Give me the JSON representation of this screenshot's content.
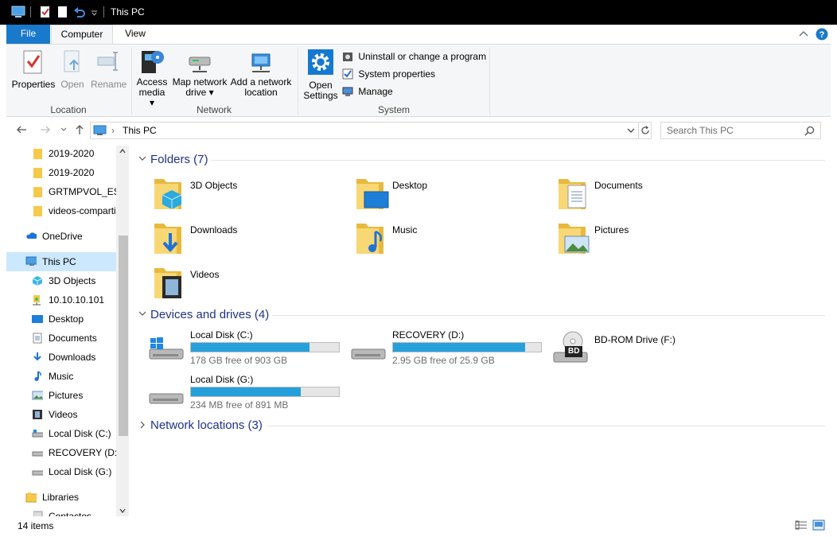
{
  "window": {
    "title": "This PC"
  },
  "tabs": {
    "file": "File",
    "computer": "Computer",
    "view": "View"
  },
  "ribbon": {
    "properties": "Properties",
    "open": "Open",
    "rename": "Rename",
    "access_media_l1": "Access",
    "access_media_l2": "media",
    "map_drive_l1": "Map network",
    "map_drive_l2": "drive",
    "add_location_l1": "Add a network",
    "add_location_l2": "location",
    "open_settings_l1": "Open",
    "open_settings_l2": "Settings",
    "uninstall": "Uninstall or change a program",
    "system_properties": "System properties",
    "manage": "Manage",
    "group_location": "Location",
    "group_network": "Network",
    "group_system": "System"
  },
  "address": {
    "path": "This PC",
    "separator": "›"
  },
  "search": {
    "placeholder": "Search This PC"
  },
  "nav": {
    "items": [
      {
        "label": "2019-2020",
        "icon": "folder-icon"
      },
      {
        "label": "2019-2020",
        "icon": "folder-icon"
      },
      {
        "label": "GRTMPVOL_ES_I",
        "icon": "folder-icon"
      },
      {
        "label": "videos-comparti",
        "icon": "folder-icon"
      },
      {
        "label": "OneDrive",
        "icon": "cloud-icon"
      },
      {
        "label": "This PC",
        "icon": "computer-icon"
      },
      {
        "label": "3D Objects",
        "icon": "cube-icon"
      },
      {
        "label": "10.10.10.101",
        "icon": "network-drive-icon"
      },
      {
        "label": "Desktop",
        "icon": "desktop-icon"
      },
      {
        "label": "Documents",
        "icon": "documents-icon"
      },
      {
        "label": "Downloads",
        "icon": "download-icon"
      },
      {
        "label": "Music",
        "icon": "music-icon"
      },
      {
        "label": "Pictures",
        "icon": "pictures-icon"
      },
      {
        "label": "Videos",
        "icon": "videos-icon"
      },
      {
        "label": "Local Disk (C:)",
        "icon": "drive-icon"
      },
      {
        "label": "RECOVERY (D:)",
        "icon": "drive-icon"
      },
      {
        "label": "Local Disk (G:)",
        "icon": "drive-icon"
      },
      {
        "label": "Libraries",
        "icon": "libraries-icon"
      },
      {
        "label": "Contactos",
        "icon": "folder-icon"
      }
    ]
  },
  "content": {
    "folders_header": "Folders (7)",
    "folders": [
      "3D Objects",
      "Desktop",
      "Documents",
      "Downloads",
      "Music",
      "Pictures",
      "Videos"
    ],
    "drives_header": "Devices and drives (4)",
    "drives": [
      {
        "name": "Local Disk (C:)",
        "free": "178 GB free of 903 GB",
        "used_fraction": 0.8
      },
      {
        "name": "RECOVERY (D:)",
        "free": "2.95 GB free of 25.9 GB",
        "used_fraction": 0.89
      },
      {
        "name": "BD-ROM Drive (F:)"
      },
      {
        "name": "Local Disk (G:)",
        "free": "234 MB free of 891 MB",
        "used_fraction": 0.74
      }
    ],
    "network_header": "Network locations (3)",
    "bd_badge": "BD"
  },
  "status": {
    "items": "14 items"
  },
  "colors": {
    "accent": "#1979ca",
    "bar_fill": "#26a0da",
    "section": "#1e3287",
    "selected": "#cce8ff"
  }
}
